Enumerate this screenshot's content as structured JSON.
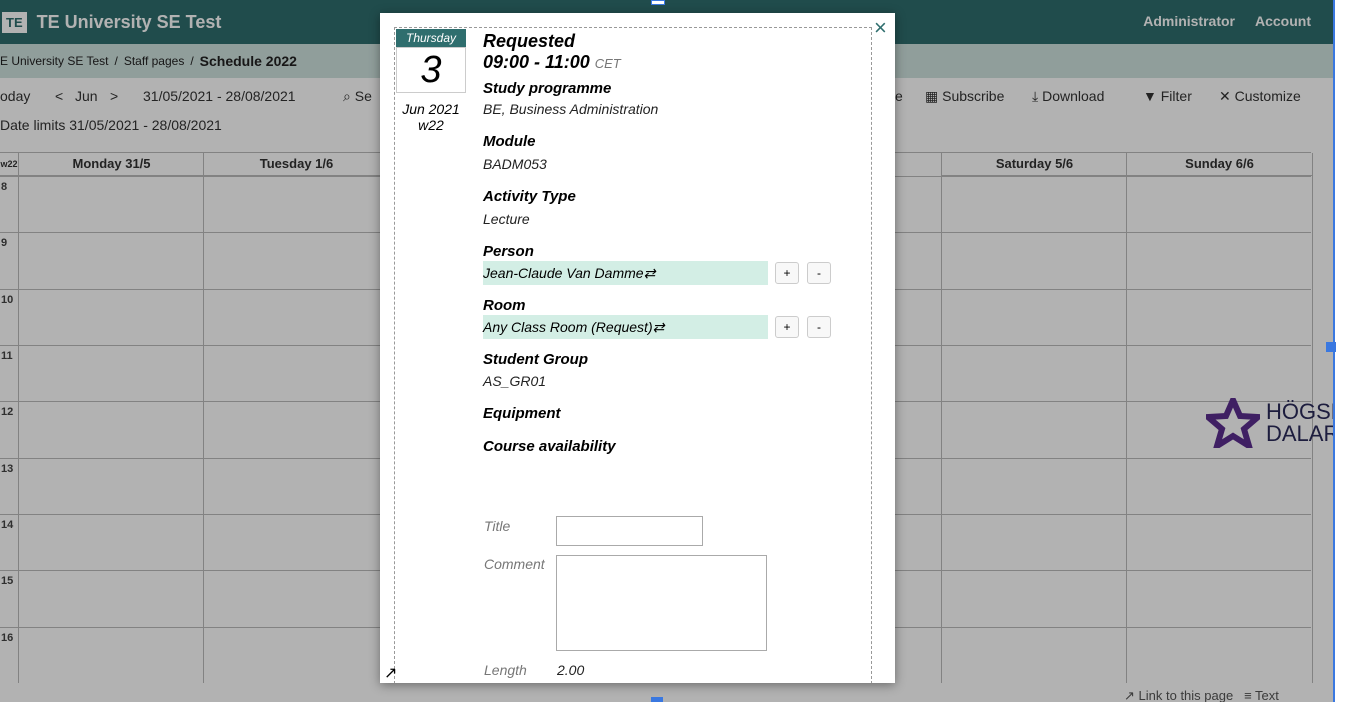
{
  "app": {
    "logo": "TE",
    "title": "TE University SE Test"
  },
  "top_nav": {
    "admin": "Administrator",
    "account": "Account"
  },
  "breadcrumb": {
    "root": "E University SE Test",
    "sep": "/",
    "staff": "Staff pages",
    "current": "Schedule 2022"
  },
  "toolbar": {
    "today": "oday",
    "prev": "<",
    "month": "Jun",
    "next": ">",
    "range": "31/05/2021 - 28/08/2021",
    "search": "Se",
    "share_partial": "e",
    "subscribe": "Subscribe",
    "download": "Download",
    "filter": "Filter",
    "customize": "Customize"
  },
  "date_limits": "Date limits 31/05/2021 - 28/08/2021",
  "calendar": {
    "week_label": "w22",
    "days": [
      "Monday 31/5",
      "Tuesday 1/6",
      "Saturday 5/6",
      "Sunday 6/6"
    ],
    "hours": [
      "8",
      "9",
      "10",
      "11",
      "12",
      "13",
      "14",
      "15",
      "16"
    ]
  },
  "side_brand": {
    "line1": "HÖGSK",
    "line2": "DALAR"
  },
  "footer": {
    "link": "Link to this page",
    "text": "Text"
  },
  "modal": {
    "close": "×",
    "day_name": "Thursday",
    "day_num": "3",
    "month_year": "Jun 2021",
    "week": "w22",
    "status": "Requested",
    "time": "09:00 - 11:00",
    "tz": "CET",
    "study_label": "Study programme",
    "study_value": "BE, Business Administration",
    "module_label": "Module",
    "module_value": "BADM053",
    "activity_label": "Activity Type",
    "activity_value": "Lecture",
    "person_label": "Person",
    "person_value": "Jean-Claude Van Damme⇄",
    "room_label": "Room",
    "room_value": "Any Class Room (Request)⇄",
    "plus": "+",
    "minus": "-",
    "group_label": "Student Group",
    "group_value": "AS_GR01",
    "equipment_label": "Equipment",
    "availability_label": "Course availability",
    "title_label": "Title",
    "comment_label": "Comment",
    "length_label": "Length",
    "length_value": "2.00"
  }
}
